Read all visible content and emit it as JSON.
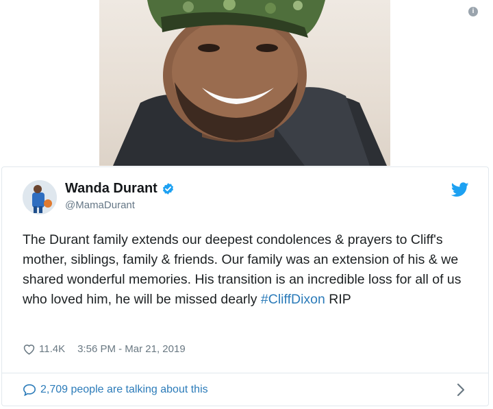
{
  "tweet": {
    "author_name": "Wanda Durant",
    "author_handle": "@MamaDurant",
    "text_parts": {
      "body": "The Durant family extends our deepest condolences & prayers to Cliff's mother, siblings, family & friends. Our family was an extension of his & we shared wonderful memories. His transition is an incredible loss for all of us who loved him, he will be missed dearly ",
      "hashtag": "#CliffDixon",
      "tail": " RIP"
    },
    "likes": "11.4K",
    "timestamp": "3:56 PM - Mar 21, 2019",
    "discussion": "2,709 people are talking about this"
  },
  "colors": {
    "link": "#2b7bb9",
    "twitter_blue": "#1da1f2",
    "verified": "#1da1f2",
    "meta_gray": "#697882"
  },
  "icons": {
    "info": "info-icon",
    "verified": "verified-badge-icon",
    "bird": "twitter-bird-icon",
    "heart": "heart-icon",
    "bubble": "speech-bubble-icon",
    "chevron": "chevron-right-icon"
  }
}
